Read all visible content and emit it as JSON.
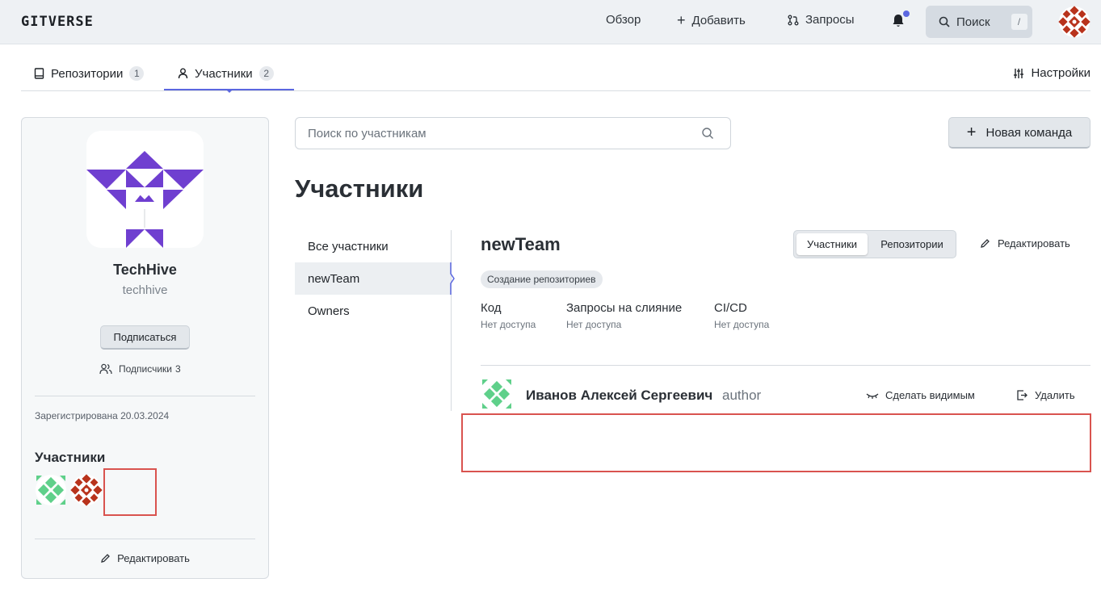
{
  "header": {
    "logo": "GITVERSE",
    "nav": {
      "overview": "Обзор",
      "add": "Добавить",
      "requests": "Запросы"
    },
    "search_label": "Поиск",
    "search_shortcut": "/",
    "notification_dot_color": "#5b67e0"
  },
  "tabs": [
    {
      "label": "Репозитории",
      "count": "1",
      "icon": "repo-icon"
    },
    {
      "label": "Участники",
      "count": "2",
      "icon": "person-icon",
      "active": true
    }
  ],
  "settings_label": "Настройки",
  "org": {
    "name": "TechHive",
    "handle": "techhive",
    "subscribe_label": "Подписаться",
    "followers_label": "Подписчики",
    "followers_count": "3",
    "registered": "Зарегистрирована 20.03.2024",
    "members_heading": "Участники",
    "edit_label": "Редактировать",
    "logo_color": "#6f3fd0"
  },
  "main": {
    "search_placeholder": "Поиск по участникам",
    "new_team_label": "Новая команда",
    "title": "Участники",
    "teams": [
      "Все участники",
      "newTeam",
      "Owners"
    ],
    "active_team": "newTeam"
  },
  "team": {
    "name": "newTeam",
    "segments": [
      "Участники",
      "Репозитории"
    ],
    "edit_label": "Редактировать",
    "badge": "Создание репозиториев",
    "permissions": [
      {
        "title": "Код",
        "value": "Нет доступа"
      },
      {
        "title": "Запросы на слияние",
        "value": "Нет доступа"
      },
      {
        "title": "CI/CD",
        "value": "Нет доступа"
      }
    ],
    "member": {
      "name": "Иванов Алексей Сергеевич",
      "role": "author",
      "make_visible_label": "Сделать видимым",
      "remove_label": "Удалить"
    }
  },
  "colors": {
    "accent": "#5b67e0",
    "highlight_box": "#d9534f",
    "avatar_green": "#5fd08a",
    "avatar_red": "#b8331c"
  }
}
